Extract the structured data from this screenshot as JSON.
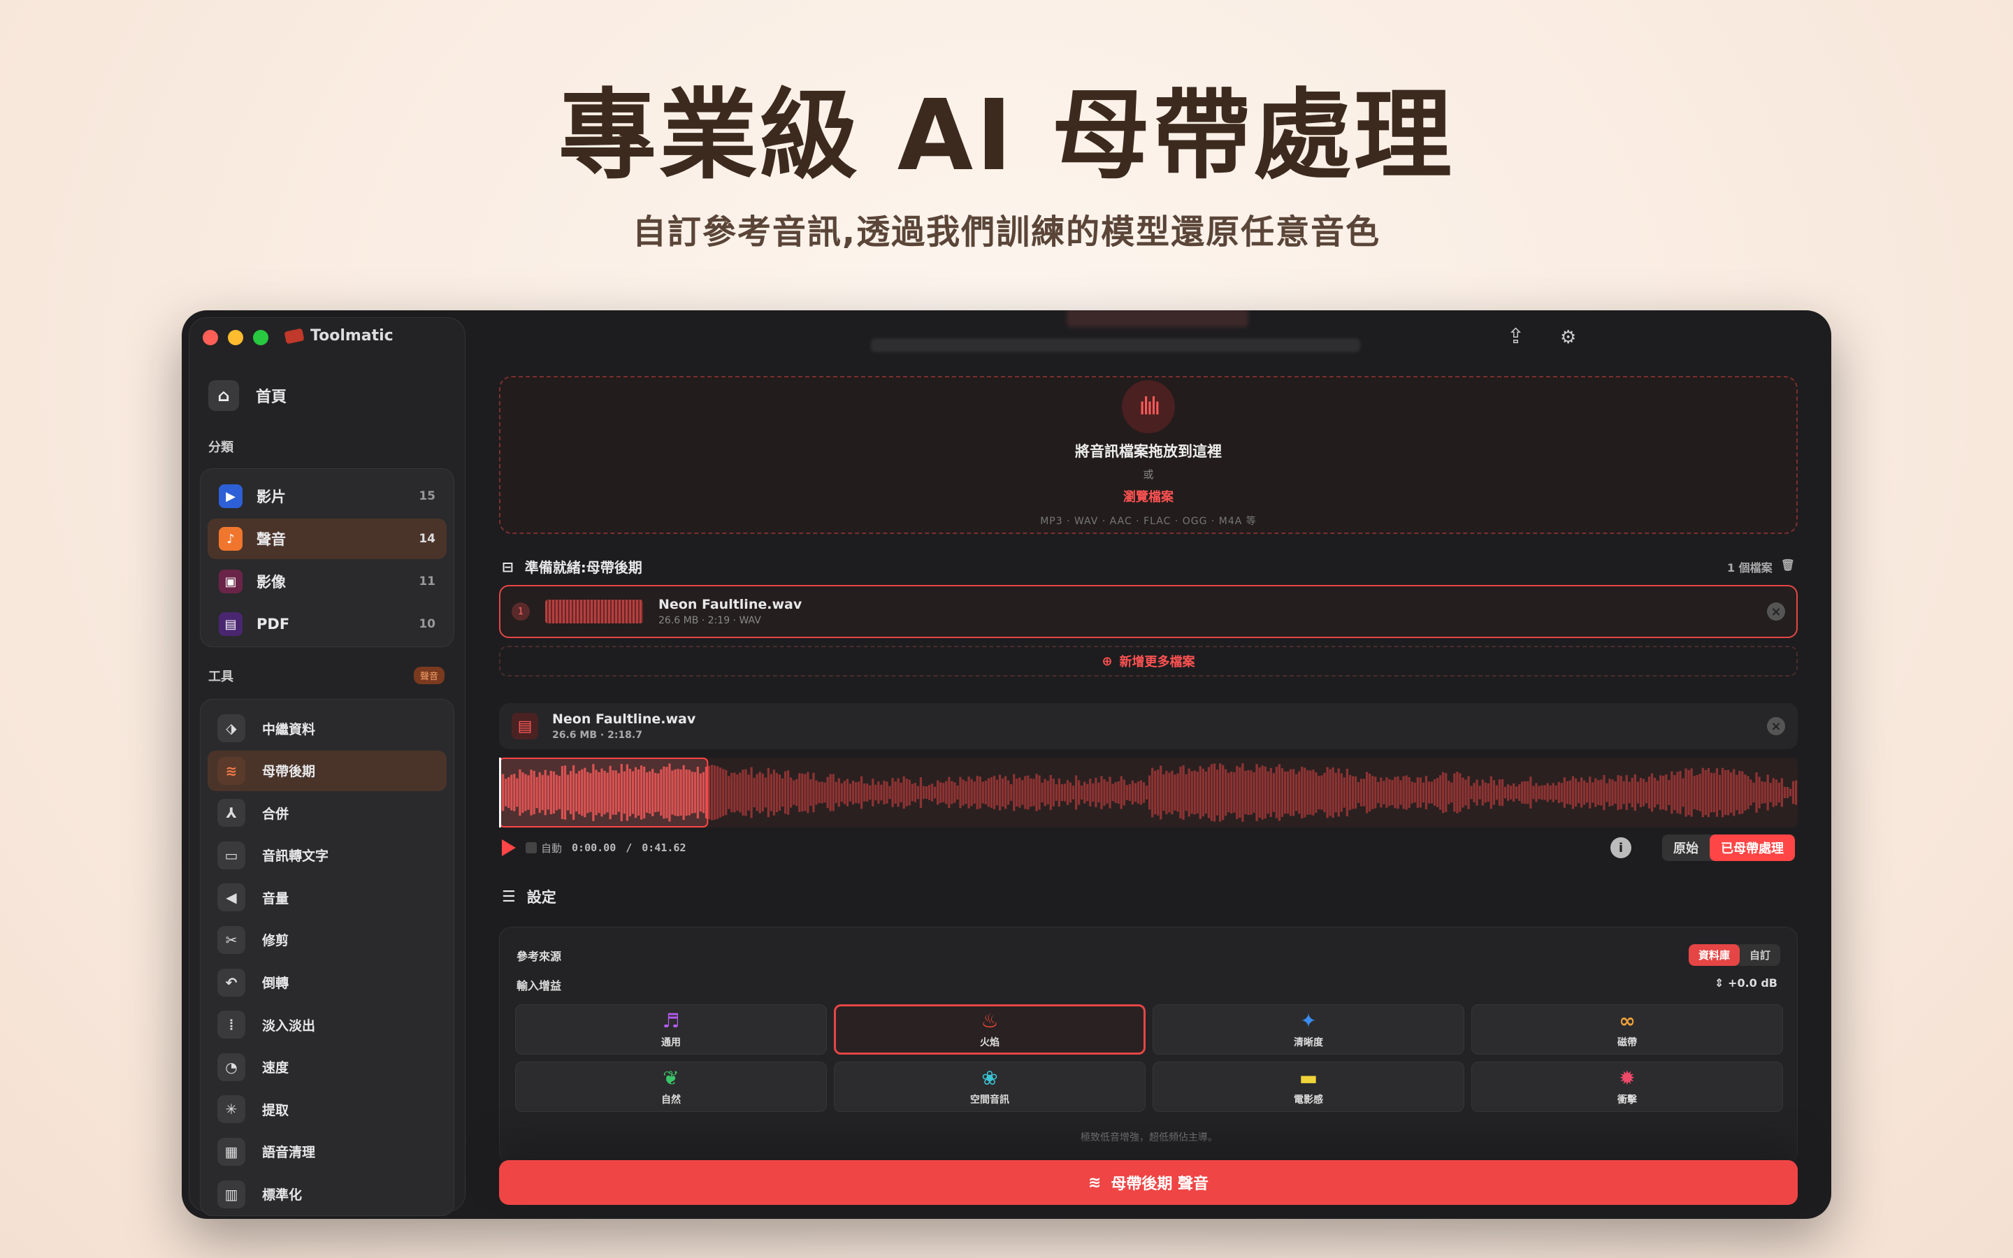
{
  "hero": {
    "title": "專業級 AI 母帶處理",
    "subtitle": "自訂參考音訊,透過我們訓練的模型還原任意音色"
  },
  "app": {
    "name": "Toolmatic",
    "home_label": "首頁",
    "categories_label": "分類",
    "tools_label": "工具",
    "tools_badge": "聲音"
  },
  "categories": [
    {
      "label": "影片",
      "count": "15",
      "icon": "video-icon",
      "color": "#2d5fd6"
    },
    {
      "label": "聲音",
      "count": "14",
      "icon": "music-note-icon",
      "color": "#f0762e"
    },
    {
      "label": "影像",
      "count": "11",
      "icon": "image-icon",
      "color": "#b8327a"
    },
    {
      "label": "PDF",
      "count": "10",
      "icon": "document-icon",
      "color": "#7a35c4"
    }
  ],
  "tools": [
    {
      "label": "中繼資料",
      "icon": "tag-icon"
    },
    {
      "label": "母帶後期",
      "icon": "waveform-icon"
    },
    {
      "label": "合併",
      "icon": "merge-icon"
    },
    {
      "label": "音訊轉文字",
      "icon": "speech-bubble-icon"
    },
    {
      "label": "音量",
      "icon": "speaker-icon"
    },
    {
      "label": "修剪",
      "icon": "scissors-icon"
    },
    {
      "label": "倒轉",
      "icon": "undo-arrow-icon"
    },
    {
      "label": "淡入淡出",
      "icon": "fade-bars-icon"
    },
    {
      "label": "速度",
      "icon": "speedometer-icon"
    },
    {
      "label": "提取",
      "icon": "extract-wave-icon"
    },
    {
      "label": "語音清理",
      "icon": "voice-clean-icon"
    },
    {
      "label": "標準化",
      "icon": "normalize-icon"
    }
  ],
  "dropzone": {
    "title": "將音訊檔案拖放到這裡",
    "or": "或",
    "browse": "瀏覽檔案",
    "formats": "MP3 · WAV · AAC · FLAC · OGG · M4A 等"
  },
  "queue": {
    "label": "準備就緒:母帶後期",
    "count": "1 個檔案",
    "add_more": "新增更多檔案"
  },
  "file": {
    "index": "1",
    "name": "Neon Faultline.wav",
    "meta": "26.6 MB · 2:19 · WAV"
  },
  "player": {
    "name": "Neon Faultline.wav",
    "meta": "26.6 MB  ·  2:18.7",
    "auto_label": "自動",
    "current_time": "0:00.00",
    "separator": "/",
    "total_time": "0:41.62",
    "original_label": "原始",
    "mastered_label": "已母帶處理",
    "selection_start": 0,
    "selection_end": 0.16
  },
  "settings": {
    "label": "設定",
    "reference_source_label": "參考來源",
    "source_options": [
      "資料庫",
      "自訂"
    ],
    "input_gain_label": "輸入增益",
    "input_gain_value": "+0.0 dB",
    "presets": [
      {
        "label": "通用",
        "icon": "music-notes-icon",
        "color": "#b45cf0",
        "glyph": "♬",
        "selected": false
      },
      {
        "label": "火焰",
        "icon": "flame-icon",
        "color": "#ff4a3a",
        "glyph": "♨",
        "selected": true
      },
      {
        "label": "清晰度",
        "icon": "sparkle-icon",
        "color": "#3a8cf0",
        "glyph": "✦",
        "selected": false
      },
      {
        "label": "磁帶",
        "icon": "cassette-icon",
        "color": "#f0a23a",
        "glyph": "∞",
        "selected": false
      },
      {
        "label": "自然",
        "icon": "leaf-icon",
        "color": "#3ac46a",
        "glyph": "❦",
        "selected": false
      },
      {
        "label": "空間音訊",
        "icon": "flower-icon",
        "color": "#3ac4d4",
        "glyph": "❀",
        "selected": false
      },
      {
        "label": "電影感",
        "icon": "film-strip-icon",
        "color": "#f0d43a",
        "glyph": "▬",
        "selected": false
      },
      {
        "label": "衝擊",
        "icon": "burst-icon",
        "color": "#f04a6a",
        "glyph": "✹",
        "selected": false
      }
    ],
    "hint": "極致低音增強，超低頻佔主導。"
  },
  "cta": {
    "label": "母帶後期 聲音"
  },
  "colors": {
    "accent": "#f04545",
    "window_bg": "#1d1d1f"
  }
}
